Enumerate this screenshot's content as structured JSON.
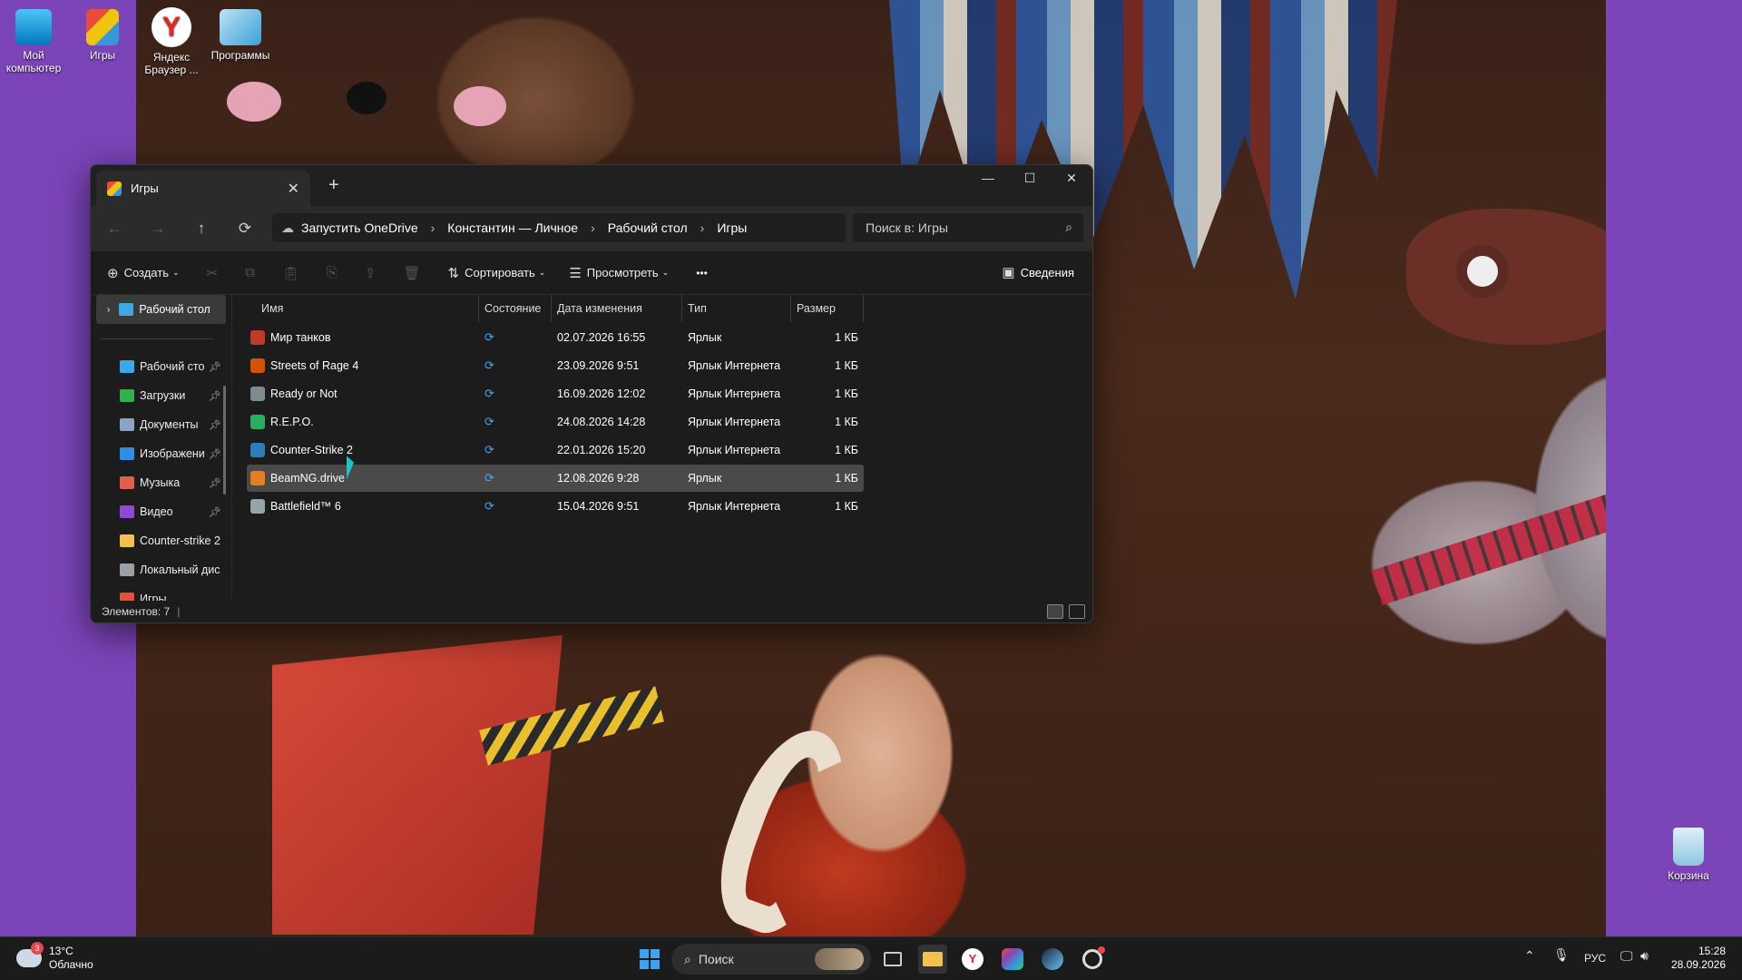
{
  "desktop_icons": [
    {
      "label": "Мой компьютер",
      "icon": "monitor-icon"
    },
    {
      "label": "Игры",
      "icon": "folder-games-icon"
    },
    {
      "label": "Яндекс Браузер ...",
      "icon": "yandex-browser-icon"
    },
    {
      "label": "Программы",
      "icon": "programs-icon"
    },
    {
      "label": "Корзина",
      "icon": "recycle-bin-icon"
    }
  ],
  "window": {
    "tab_title": "Игры",
    "tab_close": "✕",
    "new_tab": "+",
    "controls": {
      "minimize": "—",
      "maximize": "☐",
      "close": "✕"
    },
    "nav": {
      "back": "←",
      "forward": "→",
      "up": "↑",
      "refresh": "⟳"
    },
    "breadcrumb": [
      "Запустить OneDrive",
      "Константин — Личное",
      "Рабочий стол",
      "Игры"
    ],
    "breadcrumb_sep": "›",
    "search_placeholder": "Поиск в: Игры",
    "toolbar": {
      "create": "Создать",
      "sort": "Сортировать",
      "view": "Просмотреть",
      "more": "•••",
      "details": "Сведения"
    },
    "sidebar": {
      "top": "Рабочий стол",
      "items": [
        {
          "label": "Рабочий сто",
          "pinned": true,
          "color": "#3da7e8"
        },
        {
          "label": "Загрузки",
          "pinned": true,
          "color": "#2fb24c"
        },
        {
          "label": "Документы",
          "pinned": true,
          "color": "#8aa4c8"
        },
        {
          "label": "Изображени",
          "pinned": true,
          "color": "#2f8de4"
        },
        {
          "label": "Музыка",
          "pinned": true,
          "color": "#e2604a"
        },
        {
          "label": "Видео",
          "pinned": true,
          "color": "#8b4bd8"
        },
        {
          "label": "Counter-strike 2",
          "pinned": false,
          "color": "#f2c14e"
        },
        {
          "label": "Локальный дис",
          "pinned": false,
          "color": "#9aa0a6"
        },
        {
          "label": "Игры",
          "pinned": false,
          "color": "#e74c3c"
        }
      ]
    },
    "columns": [
      "Имя",
      "Состояние",
      "Дата изменения",
      "Тип",
      "Размер"
    ],
    "files": [
      {
        "name": "Мир танков",
        "date": "02.07.2026 16:55",
        "type": "Ярлык",
        "size": "1 КБ",
        "icon_color": "#c0392b",
        "selected": false
      },
      {
        "name": "Streets of Rage 4",
        "date": "23.09.2026 9:51",
        "type": "Ярлык Интернета",
        "size": "1 КБ",
        "icon_color": "#d35400",
        "selected": false
      },
      {
        "name": "Ready or Not",
        "date": "16.09.2026 12:02",
        "type": "Ярлык Интернета",
        "size": "1 КБ",
        "icon_color": "#7f8c8d",
        "selected": false
      },
      {
        "name": "R.E.P.O.",
        "date": "24.08.2026 14:28",
        "type": "Ярлык Интернета",
        "size": "1 КБ",
        "icon_color": "#27ae60",
        "selected": false
      },
      {
        "name": "Counter-Strike 2",
        "date": "22.01.2026 15:20",
        "type": "Ярлык Интернета",
        "size": "1 КБ",
        "icon_color": "#2980b9",
        "selected": false
      },
      {
        "name": "BeamNG.drive",
        "date": "12.08.2026 9:28",
        "type": "Ярлык",
        "size": "1 КБ",
        "icon_color": "#e67e22",
        "selected": true
      },
      {
        "name": "Battlefield™ 6",
        "date": "15.04.2026 9:51",
        "type": "Ярлык Интернета",
        "size": "1 КБ",
        "icon_color": "#95a5a6",
        "selected": false
      }
    ],
    "sync_glyph": "⟳",
    "status": "Элементов: 7"
  },
  "taskbar": {
    "weather_temp": "13°C",
    "weather_desc": "Облачно",
    "weather_badge": "3",
    "search": "Поиск",
    "lang": "РУС",
    "time": "15:28",
    "date": "28.09.2026"
  },
  "colors": {
    "accent": "#4aa3f0",
    "window_bg": "#1c1c1c",
    "selected_row": "#4a4a4a"
  }
}
